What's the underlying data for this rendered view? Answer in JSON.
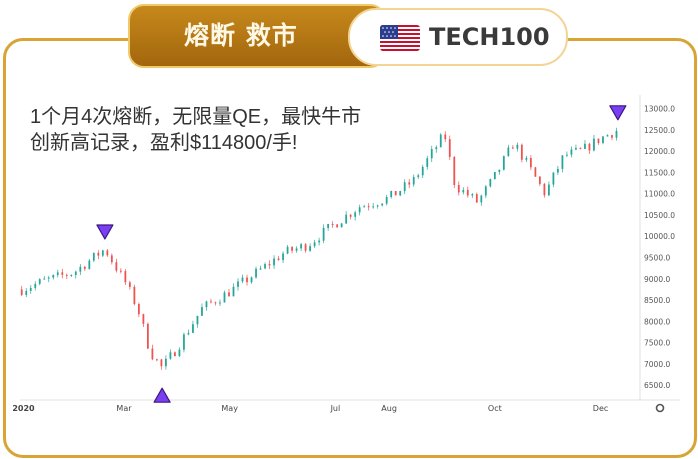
{
  "header": {
    "left_title": "熔断 救市",
    "ticker": "TECH100",
    "flag_icon": "us-flag-icon"
  },
  "headline": {
    "line1": "1个月4次熔断，无限量QE，最快牛市",
    "line2": "创新高记录，盈利$114800/手!"
  },
  "colors": {
    "gold": "#d8a534",
    "up": "#26a69a",
    "down": "#ef5350",
    "marker": "#7b3ff2"
  },
  "chart_data": {
    "type": "candlestick",
    "title": "",
    "xlabel": "",
    "ylabel": "",
    "ylim": [
      6200,
      13200
    ],
    "y_ticks": [
      "13000.0",
      "12500.0",
      "12000.0",
      "11500.0",
      "11000.0",
      "10500.0",
      "10000.0",
      "9500.0",
      "9000.0",
      "8500.0",
      "8000.0",
      "7500.0",
      "7000.0",
      "6500.0"
    ],
    "x_ticks": [
      "2020",
      "Mar",
      "May",
      "Jul",
      "Aug",
      "Oct",
      "Dec"
    ],
    "series": [
      {
        "x": [
          "2020-01-02",
          "2020-01-15",
          "2020-02-01",
          "2020-02-19",
          "2020-03-02",
          "2020-03-09",
          "2020-03-16",
          "2020-03-23",
          "2020-04-01",
          "2020-04-15",
          "2020-05-01",
          "2020-05-15",
          "2020-06-01",
          "2020-06-15",
          "2020-07-01",
          "2020-07-15",
          "2020-08-01",
          "2020-08-15",
          "2020-09-02",
          "2020-09-08",
          "2020-09-21",
          "2020-10-01",
          "2020-10-12",
          "2020-10-30",
          "2020-11-10",
          "2020-11-20",
          "2020-12-01",
          "2020-12-11"
        ],
        "values": [
          8750,
          8950,
          9150,
          9700,
          8900,
          8300,
          7300,
          6900,
          7400,
          8300,
          8700,
          9100,
          9600,
          9800,
          10300,
          10700,
          10900,
          11300,
          12400,
          11200,
          10800,
          11400,
          12200,
          11000,
          11900,
          12000,
          12300,
          12500
        ]
      }
    ],
    "annotations": [
      {
        "type": "down-marker",
        "x": "2020-02-19"
      },
      {
        "type": "up-marker",
        "x": "2020-03-23"
      },
      {
        "type": "down-marker",
        "x": "2020-12-11"
      }
    ]
  }
}
